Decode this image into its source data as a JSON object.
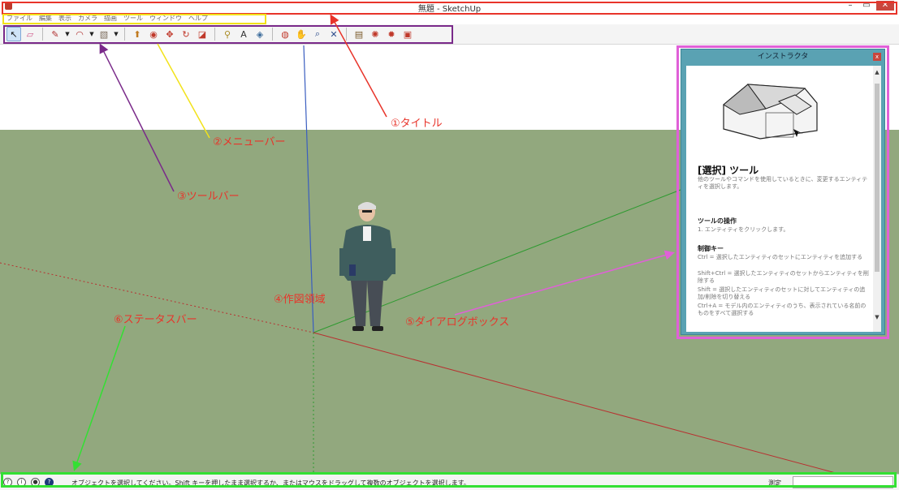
{
  "window": {
    "title": "無題 - SketchUp",
    "minimize": "–",
    "maximize": "▭",
    "close": "✕"
  },
  "menu": [
    "ファイル",
    "編集",
    "表示",
    "カメラ",
    "描画",
    "ツール",
    "ウィンドウ",
    "ヘルプ"
  ],
  "toolbar": {
    "tools": [
      {
        "name": "select-tool",
        "icon": "arrow-icon",
        "glyph": "↖",
        "color": "#111111"
      },
      {
        "name": "eraser-tool",
        "icon": "eraser-icon",
        "glyph": "▱",
        "color": "#d05a8a"
      },
      {
        "name": "line-tool",
        "icon": "pencil-icon",
        "glyph": "✎",
        "color": "#b03030"
      },
      {
        "name": "arc-tool",
        "icon": "arc-icon",
        "glyph": "◠",
        "color": "#b03030"
      },
      {
        "name": "shape-tool",
        "icon": "rectangle-icon",
        "glyph": "▧",
        "color": "#7a6a5a"
      },
      {
        "name": "push-pull-tool",
        "icon": "push-pull-icon",
        "glyph": "⬆",
        "color": "#c07a20"
      },
      {
        "name": "offset-tool",
        "icon": "offset-icon",
        "glyph": "◉",
        "color": "#c0392b"
      },
      {
        "name": "move-tool",
        "icon": "move-icon",
        "glyph": "✥",
        "color": "#c0392b"
      },
      {
        "name": "rotate-tool",
        "icon": "rotate-icon",
        "glyph": "↻",
        "color": "#c0392b"
      },
      {
        "name": "scale-tool",
        "icon": "scale-icon",
        "glyph": "◪",
        "color": "#c0392b"
      },
      {
        "name": "tape-measure-tool",
        "icon": "tape-icon",
        "glyph": "⚲",
        "color": "#a88a20"
      },
      {
        "name": "text-tool",
        "icon": "text-icon",
        "glyph": "A",
        "color": "#333333"
      },
      {
        "name": "paint-bucket-tool",
        "icon": "paint-bucket-icon",
        "glyph": "◈",
        "color": "#3a6a9a"
      },
      {
        "name": "orbit-tool",
        "icon": "orbit-icon",
        "glyph": "◍",
        "color": "#c0392b"
      },
      {
        "name": "pan-tool",
        "icon": "hand-icon",
        "glyph": "✋",
        "color": "#555555"
      },
      {
        "name": "zoom-tool",
        "icon": "magnifier-icon",
        "glyph": "⌕",
        "color": "#2a4a8a"
      },
      {
        "name": "zoom-extents-tool",
        "icon": "zoom-extents-icon",
        "glyph": "✕",
        "color": "#2a4a8a"
      },
      {
        "name": "warehouse-tool",
        "icon": "warehouse-icon",
        "glyph": "▤",
        "color": "#7a5a2a"
      },
      {
        "name": "extension-tool",
        "icon": "extension-icon",
        "glyph": "✺",
        "color": "#c0392b"
      },
      {
        "name": "ruby-tool",
        "icon": "ruby-icon",
        "glyph": "✹",
        "color": "#c0392b"
      },
      {
        "name": "layout-tool",
        "icon": "layout-icon",
        "glyph": "▣",
        "color": "#c0392b"
      }
    ]
  },
  "dialog": {
    "title": "インストラクタ",
    "close": "x",
    "heading": "[選択] ツール",
    "description": "他のツールやコマンドを使用しているときに、変更するエンティティを選択します。",
    "section1_title": "ツールの操作",
    "section1_text": "1. エンティティをクリックします。",
    "section2_title": "制御キー",
    "section2_lines": [
      "Ctrl = 選択したエンティティのセットにエンティティを追加する",
      "Shift+Ctrl = 選択したエンティティのセットからエンティティを削除する",
      "Shift = 選択したエンティティのセットに対してエンティティの追加/削除を切り替える",
      "Ctrl+A = モデル内のエンティティのうち、表示されている名前のものをすべて選択する"
    ],
    "scroll_up": "▲",
    "scroll_down": "▼"
  },
  "annotations": {
    "title": "①タイトル",
    "menubar": "②メニューバー",
    "toolbar": "③ツールバー",
    "drawing_area": "④作図領域",
    "dialog_box": "⑤ダイアログボックス",
    "status_bar": "⑥ステータスバー",
    "colors": {
      "red": "#e8342a",
      "yellow": "#f2e21a",
      "purple": "#7a2a8a",
      "magenta": "#e060d8",
      "green": "#33e033"
    }
  },
  "statusbar": {
    "icons": [
      "?",
      "i",
      "●",
      "?"
    ],
    "message": "オブジェクトを選択してください。Shift キーを押したまま選択するか、またはマウスをドラッグして複数のオブジェクトを選択します。",
    "measure_label": "測定"
  },
  "colors": {
    "sky": "#ffffff",
    "ground": "#92a87e",
    "axis_blue": "#3a5ec0",
    "axis_red": "#b83030",
    "axis_green": "#2e9a30"
  }
}
